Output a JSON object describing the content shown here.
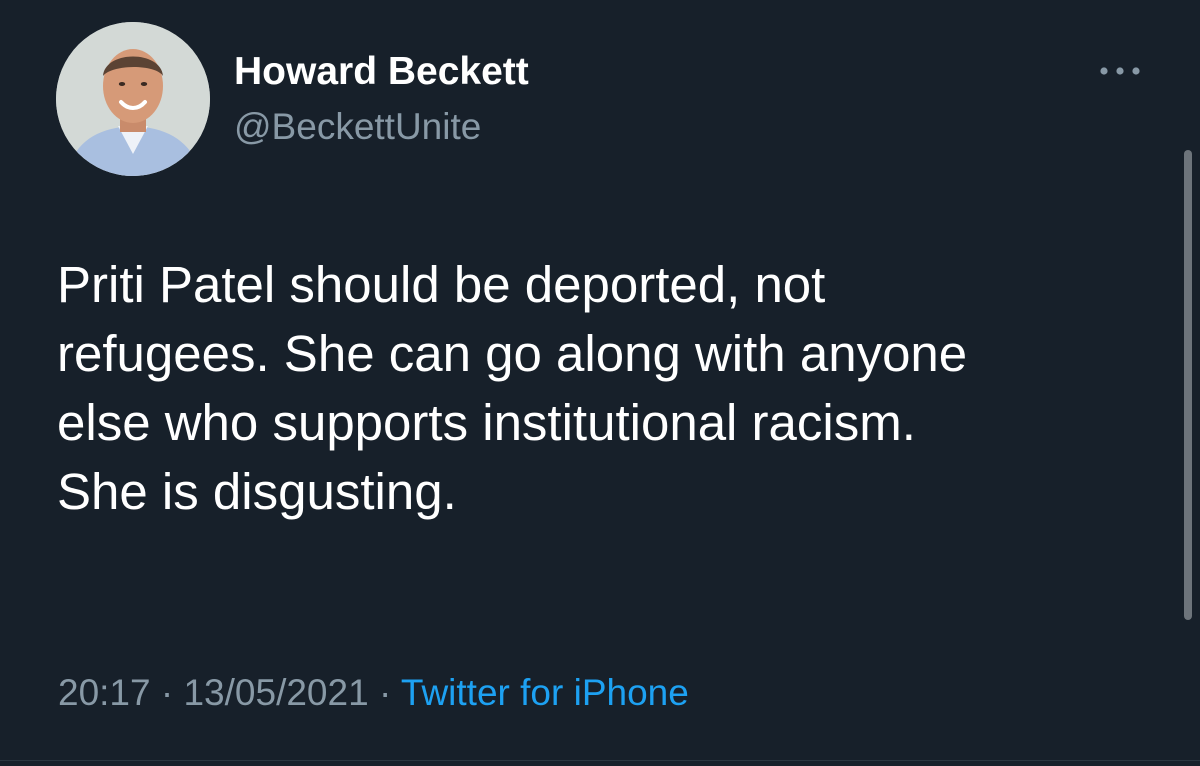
{
  "tweet": {
    "author": {
      "name": "Howard Beckett",
      "handle": "@BeckettUnite",
      "avatar": "profile-photo"
    },
    "more_icon": "ellipsis-icon",
    "text_lines": [
      "Priti Patel should be deported, not",
      "refugees. She can go along with anyone",
      "else who supports institutional racism.",
      "She is disgusting."
    ],
    "time": "20:17",
    "separator": "·",
    "date": "13/05/2021",
    "source": "Twitter for iPhone"
  },
  "colors": {
    "background": "#17202a",
    "text": "#ffffff",
    "secondary": "#8899a6",
    "link": "#1da1f2"
  }
}
